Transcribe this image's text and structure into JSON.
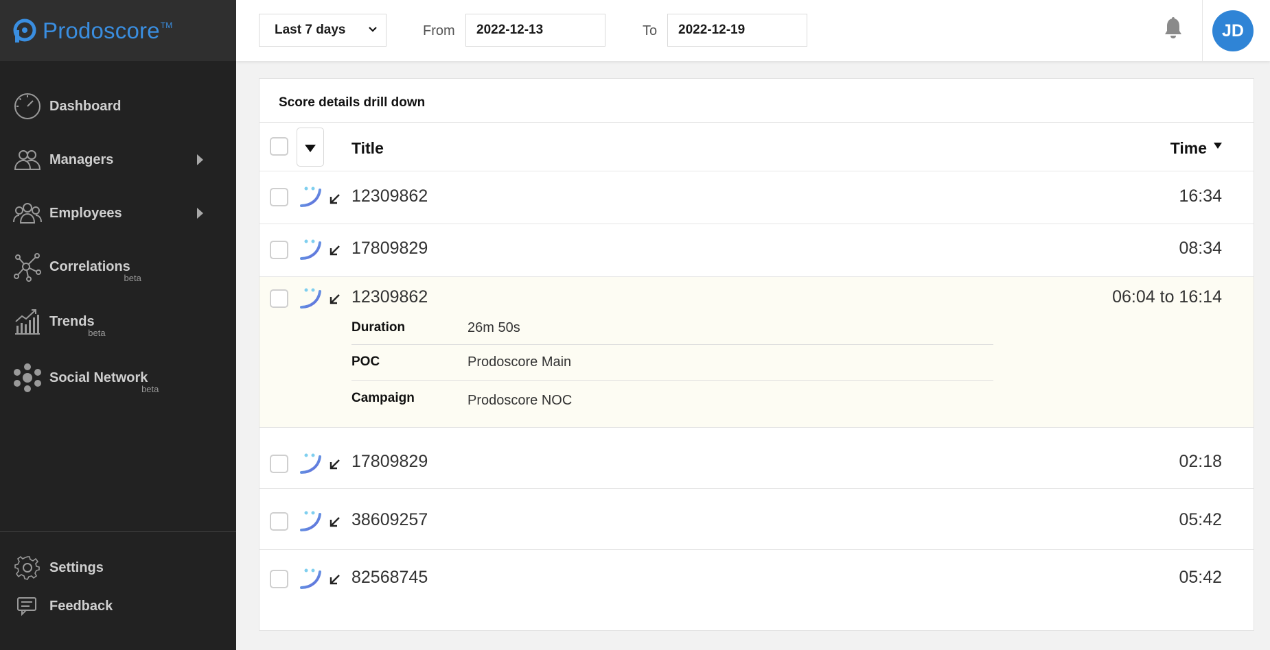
{
  "app": {
    "name": "Prodoscore",
    "tm": "TM"
  },
  "sidebar": {
    "items": [
      {
        "label": "Dashboard",
        "icon": "speedometer-icon"
      },
      {
        "label": "Managers",
        "icon": "managers-icon"
      },
      {
        "label": "Employees",
        "icon": "employees-icon"
      },
      {
        "label": "Correlations",
        "beta": "beta",
        "icon": "correlations-icon"
      },
      {
        "label": "Trends",
        "beta": "beta",
        "icon": "trends-icon"
      },
      {
        "label": "Social Network",
        "beta": "beta",
        "icon": "social-network-icon"
      }
    ],
    "footer": [
      {
        "label": "Settings",
        "icon": "gear-icon"
      },
      {
        "label": "Feedback",
        "icon": "feedback-icon"
      }
    ]
  },
  "topbar": {
    "range": "Last 7 days",
    "from_label": "From",
    "from_value": "2022-12-13",
    "to_label": "To",
    "to_value": "2022-12-19",
    "avatar_initials": "JD"
  },
  "card": {
    "title": "Score details drill down",
    "header": {
      "title": "Title",
      "time": "Time"
    },
    "rows": [
      {
        "title": "12309862",
        "time": "16:34"
      },
      {
        "title": "17809829",
        "time": "08:34"
      },
      {
        "title": "12309862",
        "time": "06:04 to 16:14",
        "details": [
          {
            "label": "Duration",
            "value": "26m 50s"
          },
          {
            "label": "POC",
            "value": "Prodoscore Main"
          },
          {
            "label": "Campaign",
            "value": "Prodoscore NOC"
          }
        ]
      },
      {
        "title": "17809829",
        "time": "02:18"
      },
      {
        "title": "38609257",
        "time": "05:42"
      },
      {
        "title": "82568745",
        "time": "05:42"
      }
    ]
  },
  "colors": {
    "brand": "#3a8ee0",
    "sidebar_bg": "#222222",
    "avatar": "#2f84d6",
    "expanded_row": "#fdfcf3"
  }
}
